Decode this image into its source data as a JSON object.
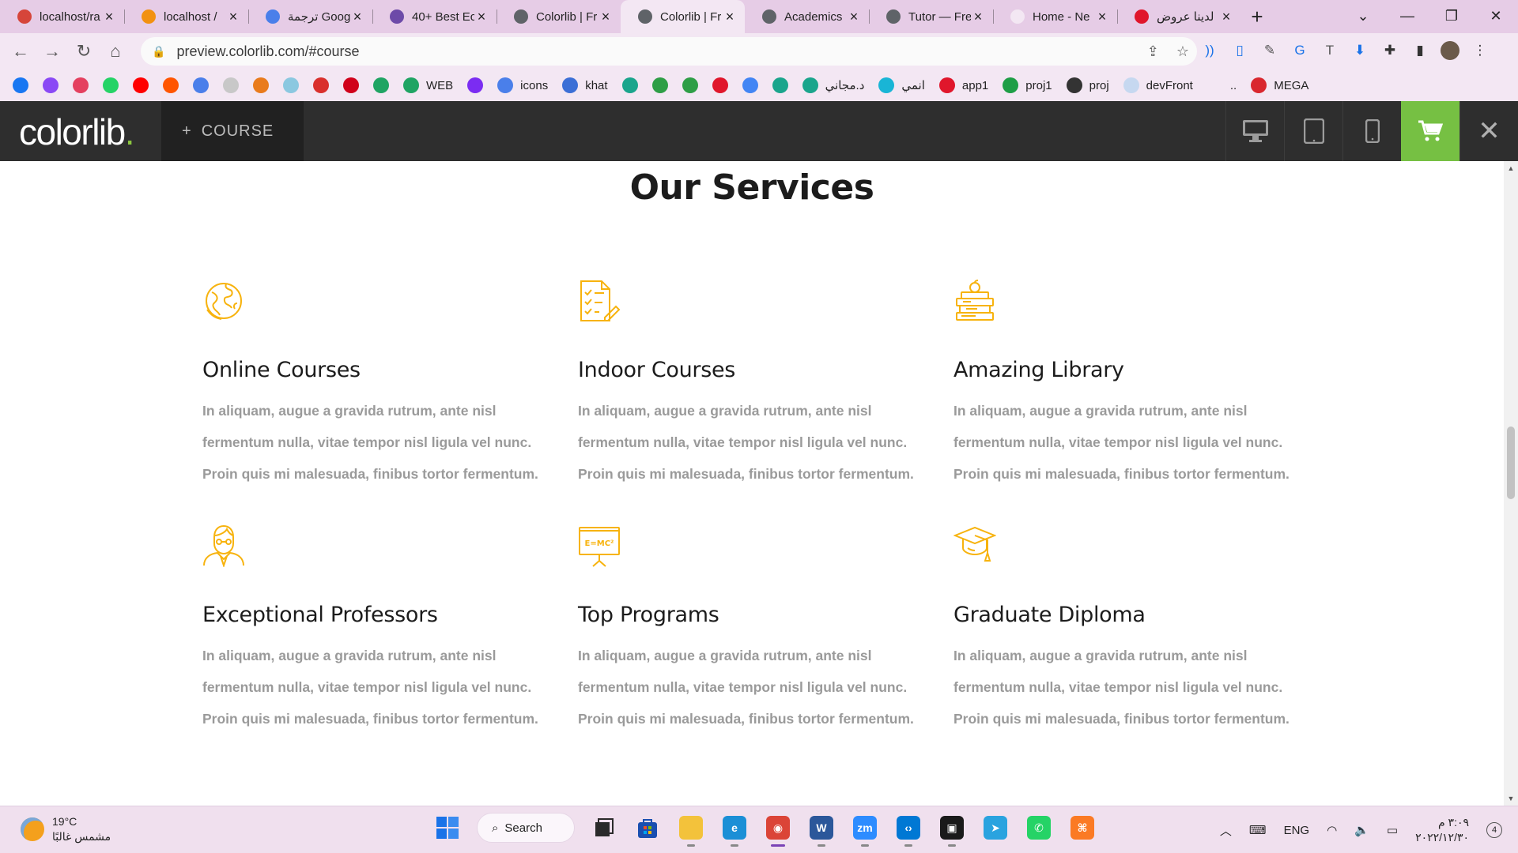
{
  "browser": {
    "tabs": [
      {
        "title": "localhost/ra",
        "color": "#d6453a",
        "icon": "xampp-icon"
      },
      {
        "title": "localhost /",
        "color": "#f29111",
        "icon": "phpmyadmin-icon"
      },
      {
        "title": "ترجمة Google",
        "color": "#4a7fea",
        "icon": "google-translate-icon"
      },
      {
        "title": "40+ Best Ec",
        "color": "#6d4aa8",
        "icon": "colorlib-icon"
      },
      {
        "title": "Colorlib | Fr",
        "color": "#5f6368",
        "icon": "globe-icon"
      },
      {
        "title": "Colorlib | Fr",
        "color": "#5f6368",
        "icon": "globe-icon",
        "active": true
      },
      {
        "title": "Academics",
        "color": "#5f6368",
        "icon": "globe-icon"
      },
      {
        "title": "Tutor — Fre",
        "color": "#5f6368",
        "icon": "globe-icon"
      },
      {
        "title": "Home - Ne",
        "color": "#f3e7f3",
        "icon": "blank-icon"
      },
      {
        "title": "لدينا عروض",
        "color": "#e0162b",
        "icon": "offers-icon"
      }
    ],
    "url": "preview.colorlib.com/#course",
    "bookmarks": [
      {
        "label": "",
        "color": "#1877f2",
        "icon": "facebook-icon"
      },
      {
        "label": "",
        "color": "#8a49f5",
        "icon": "messenger-icon"
      },
      {
        "label": "",
        "color": "#e4405f",
        "icon": "instagram-icon"
      },
      {
        "label": "",
        "color": "#25d366",
        "icon": "whatsapp-icon"
      },
      {
        "label": "",
        "color": "#ff0000",
        "icon": "youtube-icon"
      },
      {
        "label": "",
        "color": "#ff5500",
        "icon": "soundcloud-icon"
      },
      {
        "label": "",
        "color": "#4a7fea",
        "icon": "translate-icon"
      },
      {
        "label": "",
        "color": "#c8c8c8",
        "icon": "page-icon"
      },
      {
        "label": "",
        "color": "#e97b1c",
        "icon": "moodle-icon"
      },
      {
        "label": "",
        "color": "#8bc8e0",
        "icon": "cloud-icon"
      },
      {
        "label": "",
        "color": "#d9302c",
        "icon": "h-icon"
      },
      {
        "label": "",
        "color": "#d0021b",
        "icon": "mega-red-icon"
      },
      {
        "label": "",
        "color": "#1fa463",
        "icon": "drive-icon"
      },
      {
        "label": "WEB",
        "color": "#1fa463",
        "icon": "drive-icon"
      },
      {
        "label": "",
        "color": "#7b2cf2",
        "icon": "bootstrap-icon"
      },
      {
        "label": "icons",
        "color": "#4a7fea",
        "icon": "flag-icon"
      },
      {
        "label": "khat",
        "color": "#3b6fd6",
        "icon": "khat-icon"
      },
      {
        "label": "",
        "color": "#1aa58c",
        "icon": "diamond-icon"
      },
      {
        "label": "",
        "color": "#2e9e46",
        "icon": "w3-icon"
      },
      {
        "label": "",
        "color": "#2e9e46",
        "icon": "gfg-icon"
      },
      {
        "label": "",
        "color": "#e0162b",
        "icon": "v-icon"
      },
      {
        "label": "",
        "color": "#4285f4",
        "icon": "google-icon"
      },
      {
        "label": "",
        "color": "#1aa58c",
        "icon": "sg-icon"
      },
      {
        "label": "د.مجاني",
        "color": "#1aa58c",
        "icon": "shield-icon"
      },
      {
        "label": "انمي",
        "color": "#19b5d6",
        "icon": "anime-icon"
      },
      {
        "label": "app1",
        "color": "#e0162b",
        "icon": "s-icon"
      },
      {
        "label": "proj1",
        "color": "#1e9e46",
        "icon": "check-icon"
      },
      {
        "label": "proj",
        "color": "#333333",
        "icon": "globe-icon"
      },
      {
        "label": "devFront",
        "color": "#c6d8f0",
        "icon": "dev-icon"
      },
      {
        "label": "..",
        "color": "#f3e7f3",
        "icon": "more-icon"
      },
      {
        "label": "MEGA",
        "color": "#d9272e",
        "icon": "mega-icon"
      }
    ]
  },
  "preview_bar": {
    "logo_text": "colorlib",
    "logo_dot": ".",
    "course_label": "COURSE",
    "course_plus": "+"
  },
  "services": {
    "title": "Our Services",
    "accent": "#f7b30e",
    "items": [
      {
        "title": "Online Courses",
        "icon": "globe-icon",
        "text": "In aliquam, augue a gravida rutrum, ante nisl fermentum nulla, vitae tempor nisl ligula vel nunc. Proin quis mi malesuada, finibus tortor fermentum."
      },
      {
        "title": "Indoor Courses",
        "icon": "checklist-icon",
        "text": "In aliquam, augue a gravida rutrum, ante nisl fermentum nulla, vitae tempor nisl ligula vel nunc. Proin quis mi malesuada, finibus tortor fermentum."
      },
      {
        "title": "Amazing Library",
        "icon": "books-icon",
        "text": "In aliquam, augue a gravida rutrum, ante nisl fermentum nulla, vitae tempor nisl ligula vel nunc. Proin quis mi malesuada, finibus tortor fermentum."
      },
      {
        "title": "Exceptional Professors",
        "icon": "professor-icon",
        "text": "In aliquam, augue a gravida rutrum, ante nisl fermentum nulla, vitae tempor nisl ligula vel nunc. Proin quis mi malesuada, finibus tortor fermentum."
      },
      {
        "title": "Top Programs",
        "icon": "blackboard-icon",
        "text": "In aliquam, augue a gravida rutrum, ante nisl fermentum nulla, vitae tempor nisl ligula vel nunc. Proin quis mi malesuada, finibus tortor fermentum."
      },
      {
        "title": "Graduate Diploma",
        "icon": "graduation-cap-icon",
        "text": "In aliquam, augue a gravida rutrum, ante nisl fermentum nulla, vitae tempor nisl ligula vel nunc. Proin quis mi malesuada, finibus tortor fermentum."
      }
    ]
  },
  "taskbar": {
    "temperature": "19°C",
    "weather_text": "مشمس غالبًا",
    "search_label": "Search",
    "language": "ENG",
    "time": "٣:٠٩ م",
    "date": "٢٠٢٢/١٢/٣٠",
    "notifications": "4",
    "apps": [
      {
        "name": "file-explorer-icon",
        "color": "#f3c23b",
        "glyph": ""
      },
      {
        "name": "edge-icon",
        "color": "#1b8fd6",
        "glyph": "e"
      },
      {
        "name": "chrome-icon",
        "color": "#db4437",
        "glyph": "◉"
      },
      {
        "name": "word-icon",
        "color": "#2b579a",
        "glyph": "W"
      },
      {
        "name": "zoom-icon",
        "color": "#2d8cff",
        "glyph": "zm"
      },
      {
        "name": "vscode-icon",
        "color": "#0078d4",
        "glyph": "‹›"
      },
      {
        "name": "terminal-icon",
        "color": "#1a1a1a",
        "glyph": "▣"
      },
      {
        "name": "telegram-icon",
        "color": "#2aa3df",
        "glyph": "➤"
      },
      {
        "name": "whatsapp-icon",
        "color": "#25d366",
        "glyph": "✆"
      },
      {
        "name": "xampp-icon",
        "color": "#fb7a24",
        "glyph": "⌘"
      }
    ]
  }
}
